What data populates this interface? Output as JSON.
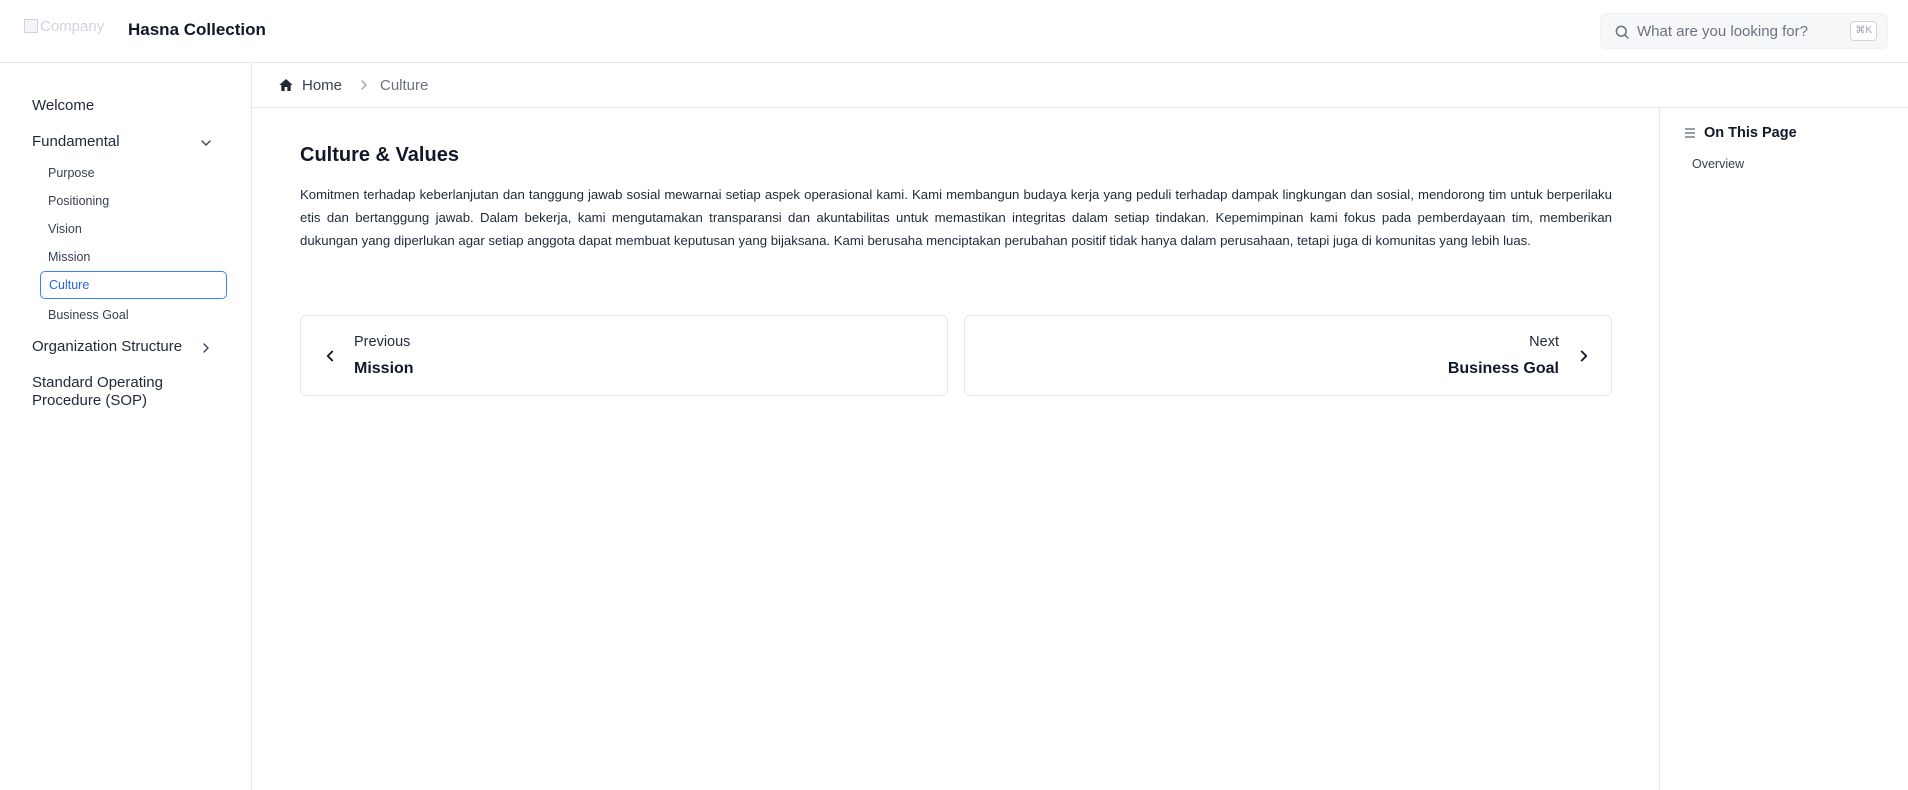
{
  "header": {
    "logo_alt": "Company",
    "brand": "Hasna Collection",
    "search": {
      "placeholder": "What are you looking for?",
      "shortcut": "⌘K"
    }
  },
  "sidebar": {
    "welcome": "Welcome",
    "fundamental": {
      "label": "Fundamental",
      "items": [
        "Purpose",
        "Positioning",
        "Vision",
        "Mission",
        "Culture",
        "Business Goal"
      ],
      "active": "Culture"
    },
    "organization": "Organization Structure",
    "sop_line1": "Standard Operating",
    "sop_line2": "Procedure (SOP)"
  },
  "breadcrumb": {
    "home": "Home",
    "current": "Culture"
  },
  "main": {
    "title": "Culture & Values",
    "body": "Komitmen terhadap keberlanjutan dan tanggung jawab sosial mewarnai setiap aspek operasional kami. Kami membangun budaya kerja yang peduli terhadap dampak lingkungan dan sosial, mendorong tim untuk berperilaku etis dan bertanggung jawab. Dalam bekerja, kami mengutamakan transparansi dan akuntabilitas untuk memastikan integritas dalam setiap tindakan. Kepemimpinan kami fokus pada pemberdayaan tim, memberikan dukungan yang diperlukan agar setiap anggota dapat membuat keputusan yang bijaksana. Kami berusaha menciptakan perubahan positif tidak hanya dalam perusahaan, tetapi juga di komunitas yang lebih luas.",
    "prev": {
      "label": "Previous",
      "title": "Mission"
    },
    "next": {
      "label": "Next",
      "title": "Business Goal"
    }
  },
  "toc": {
    "title": "On This Page",
    "items": [
      "Overview"
    ]
  },
  "colors": {
    "accent": "#3b82f6",
    "border": "#e5e7eb",
    "text": "#111827"
  }
}
